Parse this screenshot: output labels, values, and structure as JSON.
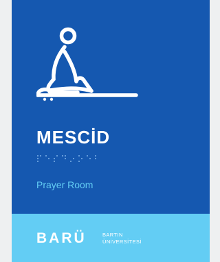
{
  "sign": {
    "title": "MESCİD",
    "subtitle": "Prayer Room",
    "braille": "⠍⠑⠎⠉⠊⠙"
  },
  "brand": {
    "logo": "BARÜ",
    "name_line1": "BARTIN",
    "name_line2": "ÜNİVERSİTESİ"
  },
  "icons": {
    "pictogram": "praying-person-icon"
  },
  "colors": {
    "primary_blue": "#1558b0",
    "light_blue": "#63cdf4",
    "background": "#eef0f1",
    "white": "#ffffff"
  }
}
